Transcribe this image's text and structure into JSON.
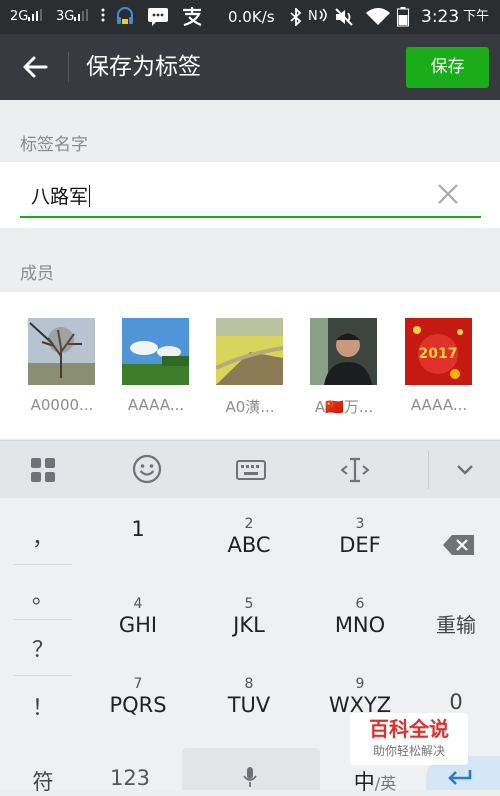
{
  "status_bar": {
    "signal1": "2G",
    "signal2": "3G",
    "speed": "0.0K/s",
    "nfc": "N",
    "time": "3:23",
    "ampm": "下午"
  },
  "app_bar": {
    "title": "保存为标签",
    "save_label": "保存"
  },
  "tag_section": {
    "label": "标签名字",
    "input_value": "八路军"
  },
  "members_section": {
    "label": "成员",
    "members": [
      {
        "name": "A0000..."
      },
      {
        "name": "AAAA..."
      },
      {
        "name": "A0潢..."
      },
      {
        "name": "A🇨🇳万..."
      },
      {
        "name": "AAAA..."
      }
    ]
  },
  "keyboard": {
    "symbols": [
      "，",
      "。",
      "？",
      "！"
    ],
    "keys": [
      {
        "sub": "",
        "main": "1"
      },
      {
        "sub": "2",
        "main": "ABC"
      },
      {
        "sub": "3",
        "main": "DEF"
      },
      {
        "sub": "4",
        "main": "GHI"
      },
      {
        "sub": "5",
        "main": "JKL"
      },
      {
        "sub": "6",
        "main": "MNO"
      },
      {
        "sub": "7",
        "main": "PQRS"
      },
      {
        "sub": "8",
        "main": "TUV"
      },
      {
        "sub": "9",
        "main": "WXYZ"
      }
    ],
    "reinput_label": "重输",
    "zero_label": "0",
    "symbol_label": "符",
    "num_label": "123",
    "lang_main": "中",
    "lang_sub": "/英"
  },
  "watermark": {
    "line1": "百科全说",
    "line2": "助你轻松解决"
  }
}
